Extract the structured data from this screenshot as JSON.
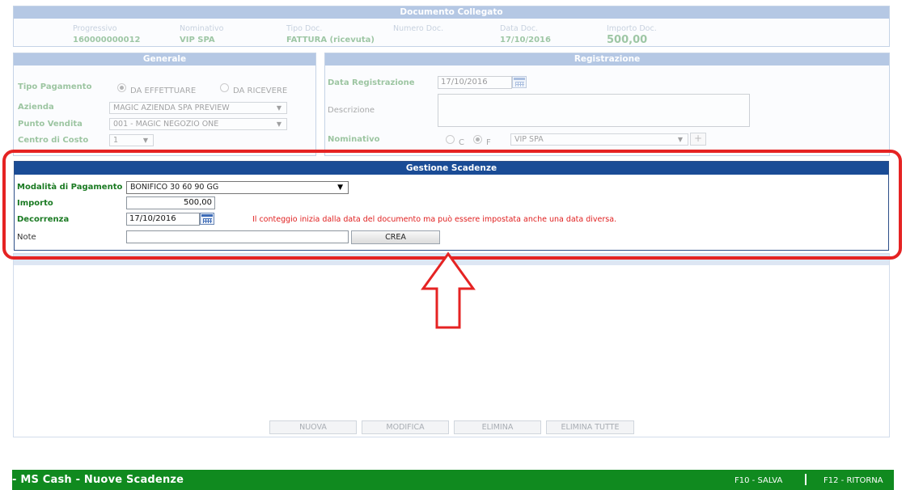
{
  "documento_collegato": {
    "title": "Documento Collegato",
    "fields": [
      {
        "label": "Progressivo",
        "value": "160000000012"
      },
      {
        "label": "Nominativo",
        "value": "VIP SPA"
      },
      {
        "label": "Tipo Doc.",
        "value": "FATTURA (ricevuta)"
      },
      {
        "label": "Numero Doc.",
        "value": ""
      },
      {
        "label": "Data Doc.",
        "value": "17/10/2016"
      },
      {
        "label": "Importo Doc.",
        "value": "500,00"
      }
    ]
  },
  "generale": {
    "title": "Generale",
    "tipo_pagamento_label": "Tipo Pagamento",
    "radio_effettuare": "DA EFFETTUARE",
    "radio_ricevere": "DA RICEVERE",
    "azienda_label": "Azienda",
    "azienda_value": "MAGIC AZIENDA SPA PREVIEW",
    "punto_vendita_label": "Punto Vendita",
    "punto_vendita_value": "001 - MAGIC NEGOZIO ONE",
    "centro_costo_label": "Centro di Costo",
    "centro_costo_value": "1"
  },
  "registrazione": {
    "title": "Registrazione",
    "data_label": "Data Registrazione",
    "data_value": "17/10/2016",
    "descrizione_label": "Descrizione",
    "descrizione_value": "",
    "nominativo_label": "Nominativo",
    "radio_c": "C",
    "radio_f": "F",
    "nominativo_value": "VIP SPA",
    "plus_label": "+"
  },
  "gestione_scadenze": {
    "title": "Gestione Scadenze",
    "modalita_label": "Modalità di Pagamento",
    "modalita_value": "BONIFICO 30 60 90 GG",
    "importo_label": "Importo",
    "importo_value": "500,00",
    "decorrenza_label": "Decorrenza",
    "decorrenza_value": "17/10/2016",
    "decorrenza_hint": "Il conteggio inizia dalla data del documento ma può essere impostata anche una data diversa.",
    "note_label": "Note",
    "note_value": "",
    "crea_label": "CREA"
  },
  "list_buttons": {
    "nuova": "NUOVA",
    "modifica": "MODIFICA",
    "elimina": "ELIMINA",
    "elimina_tutte": "ELIMINA TUTTE"
  },
  "bottom_bar": {
    "app_title": "- MS Cash - Nuove Scadenze",
    "f10": "F10 - SALVA",
    "f12": "F12 - RITORNA"
  },
  "colors": {
    "highlight": "#e52323",
    "bar_green": "#108a1f",
    "header_blue": "#1a4c96",
    "label_green": "#1a7a22",
    "warning_red": "#e02020"
  }
}
